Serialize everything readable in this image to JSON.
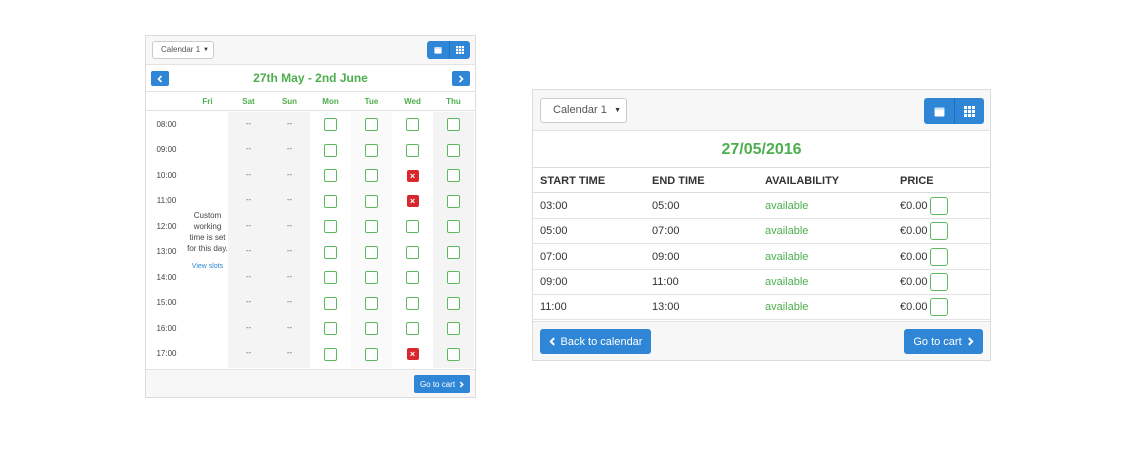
{
  "week_view": {
    "calendar_select": "Calendar 1",
    "range_title": "27th May - 2nd June",
    "days": [
      "Fri",
      "Sat",
      "Sun",
      "Mon",
      "Tue",
      "Wed",
      "Thu"
    ],
    "times": [
      "08:00",
      "09:00",
      "10:00",
      "11:00",
      "12:00",
      "13:00",
      "14:00",
      "15:00",
      "16:00",
      "17:00"
    ],
    "unavailable_marker": "--",
    "custom_note": [
      "Custom",
      "working",
      "time is set",
      "for this day."
    ],
    "view_slots_link": "View slots",
    "booked_slots": [
      {
        "day": "Wed",
        "time": "10:00"
      },
      {
        "day": "Wed",
        "time": "11:00"
      },
      {
        "day": "Wed",
        "time": "17:00"
      }
    ],
    "booked_marker": "×",
    "go_to_cart": "Go to cart",
    "colors": {
      "accent": "#2f86d6",
      "green": "#4cae4c",
      "booked": "#d9272e"
    }
  },
  "day_view": {
    "calendar_select": "Calendar 1",
    "date": "27/05/2016",
    "columns": [
      "START TIME",
      "END TIME",
      "AVAILABILITY",
      "PRICE"
    ],
    "rows": [
      {
        "start": "03:00",
        "end": "05:00",
        "availability": "available",
        "price": "€0.00"
      },
      {
        "start": "05:00",
        "end": "07:00",
        "availability": "available",
        "price": "€0.00"
      },
      {
        "start": "07:00",
        "end": "09:00",
        "availability": "available",
        "price": "€0.00"
      },
      {
        "start": "09:00",
        "end": "11:00",
        "availability": "available",
        "price": "€0.00"
      },
      {
        "start": "11:00",
        "end": "13:00",
        "availability": "available",
        "price": "€0.00"
      }
    ],
    "back_button": "Back to calendar",
    "go_to_cart": "Go to cart"
  },
  "icons": [
    "calendar-icon",
    "grid-icon",
    "chevron-left-icon",
    "chevron-right-icon",
    "caret-down-icon",
    "close-icon"
  ]
}
